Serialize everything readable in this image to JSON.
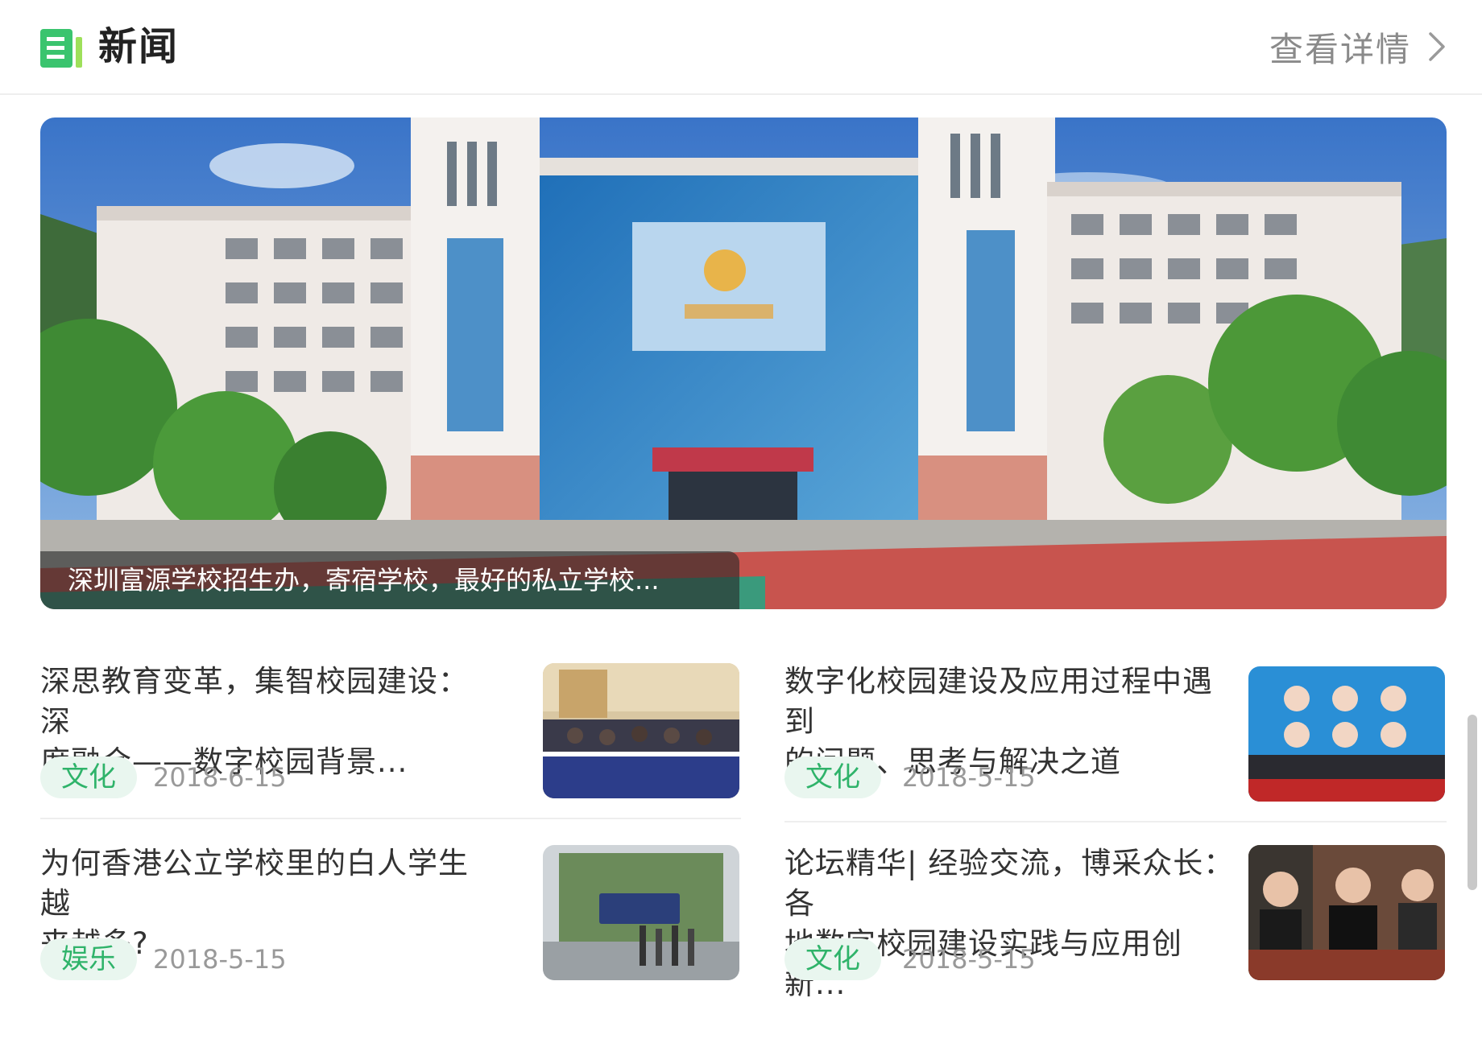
{
  "header": {
    "title": "新闻",
    "more_label": "查看详情"
  },
  "hero": {
    "caption": "深圳富源学校招生办，寄宿学校，最好的私立学校..."
  },
  "news": [
    {
      "title_line1": "深思教育变革，集智校园建设：深",
      "title_line2": "度融合——数字校园背景...",
      "tag": "文化",
      "date": "2018-6-15"
    },
    {
      "title_line1": "数字化校园建设及应用过程中遇到",
      "title_line2": "的问题、思考与解决之道",
      "tag": "文化",
      "date": "2018-5-15"
    },
    {
      "title_line1": "为何香港公立学校里的白人学生越",
      "title_line2": "来越多?",
      "tag": "娱乐",
      "date": "2018-5-15"
    },
    {
      "title_line1": "论坛精华| 经验交流，博采众长：各",
      "title_line2": "地数字校园建设实践与应用创新...",
      "tag": "文化",
      "date": "2018-5-15"
    }
  ],
  "colors": {
    "accent_green": "#2fb36a",
    "tag_bg": "#e9f6ef"
  },
  "icons": {
    "logo": "news-list-icon",
    "more": "chevron-right-icon"
  }
}
